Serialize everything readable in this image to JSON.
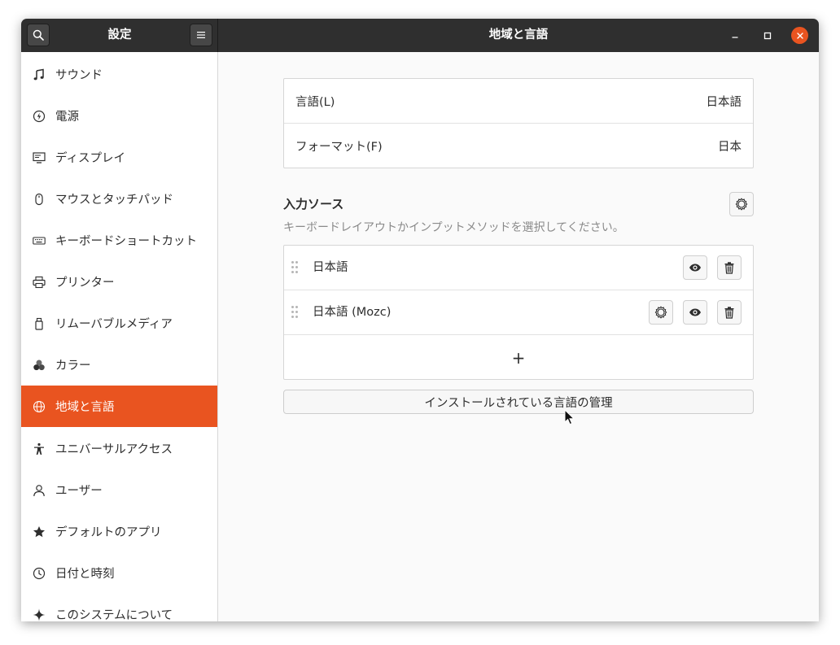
{
  "titlebar": {
    "left_title": "設定",
    "main_title": "地域と言語"
  },
  "sidebar": {
    "items": [
      {
        "label": "サウンド",
        "icon": "music-note-icon"
      },
      {
        "label": "電源",
        "icon": "power-icon"
      },
      {
        "label": "ディスプレイ",
        "icon": "display-icon"
      },
      {
        "label": "マウスとタッチパッド",
        "icon": "mouse-icon"
      },
      {
        "label": "キーボードショートカット",
        "icon": "keyboard-icon"
      },
      {
        "label": "プリンター",
        "icon": "printer-icon"
      },
      {
        "label": "リムーバブルメディア",
        "icon": "removable-media-icon"
      },
      {
        "label": "カラー",
        "icon": "color-icon"
      },
      {
        "label": "地域と言語",
        "icon": "globe-icon",
        "active": true
      },
      {
        "label": "ユニバーサルアクセス",
        "icon": "accessibility-icon"
      },
      {
        "label": "ユーザー",
        "icon": "user-icon"
      },
      {
        "label": "デフォルトのアプリ",
        "icon": "star-icon"
      },
      {
        "label": "日付と時刻",
        "icon": "clock-icon"
      },
      {
        "label": "このシステムについて",
        "icon": "sparkle-icon"
      }
    ]
  },
  "main": {
    "language": {
      "label": "言語(L)",
      "value": "日本語"
    },
    "formats": {
      "label": "フォーマット(F)",
      "value": "日本"
    },
    "input_sources": {
      "title": "入力ソース",
      "subtitle": "キーボードレイアウトかインプットメソッドを選択してください。",
      "items": [
        {
          "label": "日本語"
        },
        {
          "label": "日本語 (Mozc)"
        }
      ],
      "add_label": "+"
    },
    "manage_button": "インストールされている言語の管理"
  },
  "colors": {
    "accent": "#e95420",
    "titlebar": "#2f2f2f"
  }
}
